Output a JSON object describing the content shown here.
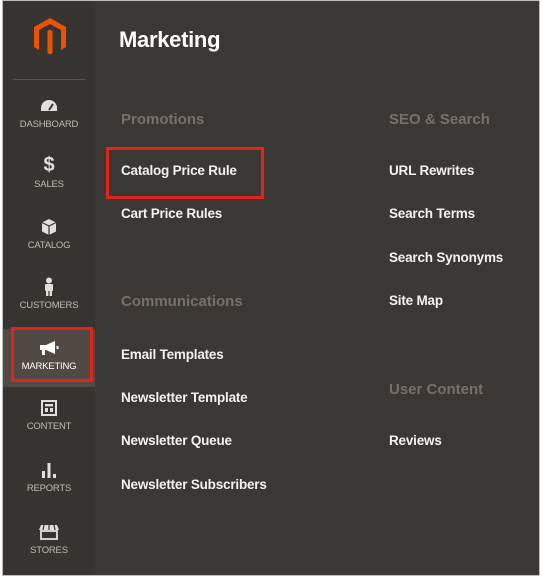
{
  "sidebar": {
    "logo_icon": "magento-logo-icon",
    "items": [
      {
        "label": "DASHBOARD",
        "icon": "dashboard-gauge-icon"
      },
      {
        "label": "SALES",
        "icon": "dollar-icon"
      },
      {
        "label": "CATALOG",
        "icon": "box-icon"
      },
      {
        "label": "CUSTOMERS",
        "icon": "person-icon"
      },
      {
        "label": "MARKETING",
        "icon": "megaphone-icon",
        "active": true
      },
      {
        "label": "CONTENT",
        "icon": "layout-icon"
      },
      {
        "label": "REPORTS",
        "icon": "bar-chart-icon"
      },
      {
        "label": "STORES",
        "icon": "store-icon"
      }
    ]
  },
  "panel": {
    "title": "Marketing",
    "promotions": {
      "title": "Promotions",
      "links": [
        "Catalog Price Rule",
        "Cart Price Rules"
      ]
    },
    "communications": {
      "title": "Communications",
      "links": [
        "Email Templates",
        "Newsletter Template",
        "Newsletter Queue",
        "Newsletter Subscribers"
      ]
    },
    "seo": {
      "title": "SEO & Search",
      "links": [
        "URL Rewrites",
        "Search Terms",
        "Search Synonyms",
        "Site Map"
      ]
    },
    "user_content": {
      "title": "User Content",
      "links": [
        "Reviews"
      ]
    }
  },
  "colors": {
    "highlight": "#e2231a",
    "logo": "#eb5202",
    "sidebar_bg": "#373330",
    "panel_bg": "#3b3735"
  }
}
